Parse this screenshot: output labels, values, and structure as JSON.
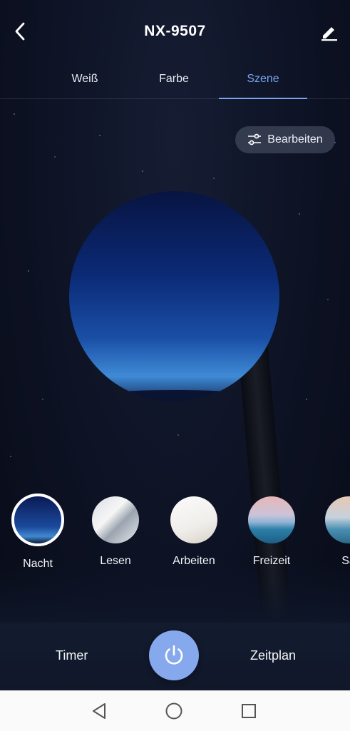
{
  "header": {
    "title": "NX-9507",
    "back_icon": "chevron-left-icon",
    "edit_icon": "pencil-icon"
  },
  "tabs": [
    {
      "label": "Weiß",
      "active": false
    },
    {
      "label": "Farbe",
      "active": false
    },
    {
      "label": "Szene",
      "active": true
    }
  ],
  "edit_chip": {
    "label": "Bearbeiten",
    "icon": "sliders-icon"
  },
  "scene": {
    "current": "Nacht"
  },
  "presets": [
    {
      "label": "Nacht",
      "selected": true
    },
    {
      "label": "Lesen",
      "selected": false
    },
    {
      "label": "Arbeiten",
      "selected": false
    },
    {
      "label": "Freizeit",
      "selected": false
    },
    {
      "label": "Sa",
      "selected": false
    }
  ],
  "controls": {
    "timer_label": "Timer",
    "schedule_label": "Zeitplan",
    "power_icon": "power-icon"
  },
  "colors": {
    "accent": "#7aa3f0",
    "power_button": "#86a8ec"
  }
}
